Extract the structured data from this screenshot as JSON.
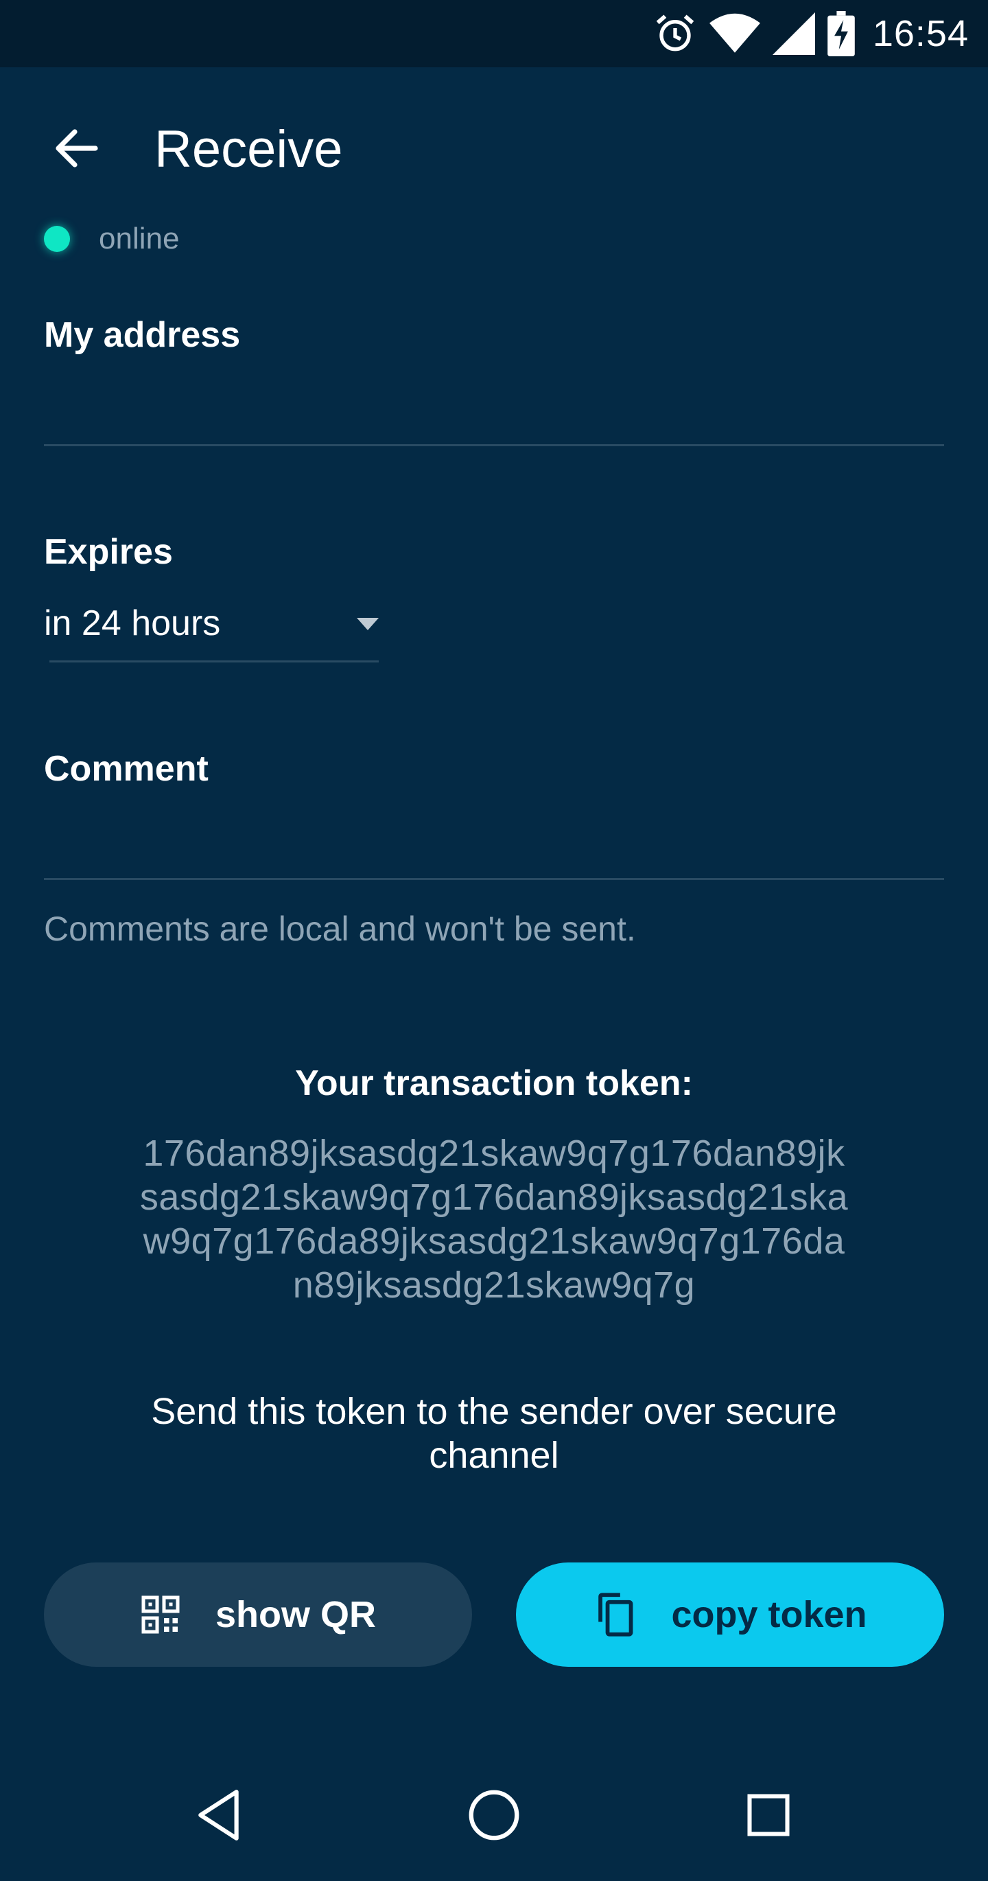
{
  "status_bar": {
    "time": "16:54",
    "icons": [
      "alarm-icon",
      "wifi-icon",
      "signal-icon",
      "battery-charging-icon"
    ]
  },
  "header": {
    "title": "Receive",
    "back_icon": "arrow-left-icon"
  },
  "connection": {
    "status": "online",
    "color": "#0fe6c4"
  },
  "form": {
    "address_label": "My address",
    "address_value": "",
    "expires_label": "Expires",
    "expires_value": "in 24 hours",
    "comment_label": "Comment",
    "comment_value": "",
    "comment_hint": "Comments are local and won't be sent."
  },
  "token": {
    "title": "Your transaction token:",
    "value": "176dan89jksasdg21skaw9q7g176dan89jksasdg21skaw9q7g176dan89jksasdg21skaw9q7g176da89jksasdg21skaw9q7g176dan89jksasdg21skaw9q7g",
    "instructions": "Send this token to the sender over secure channel"
  },
  "actions": {
    "show_qr_label": "show QR",
    "copy_token_label": "copy token",
    "show_qr_icon": "qr-code-icon",
    "copy_token_icon": "copy-icon"
  },
  "colors": {
    "background": "#042a45",
    "accent": "#0bc9ee",
    "secondary_button": "#1c3f58",
    "online": "#0fe6c4"
  },
  "nav": {
    "icons": [
      "nav-back-icon",
      "nav-home-icon",
      "nav-recents-icon"
    ]
  }
}
